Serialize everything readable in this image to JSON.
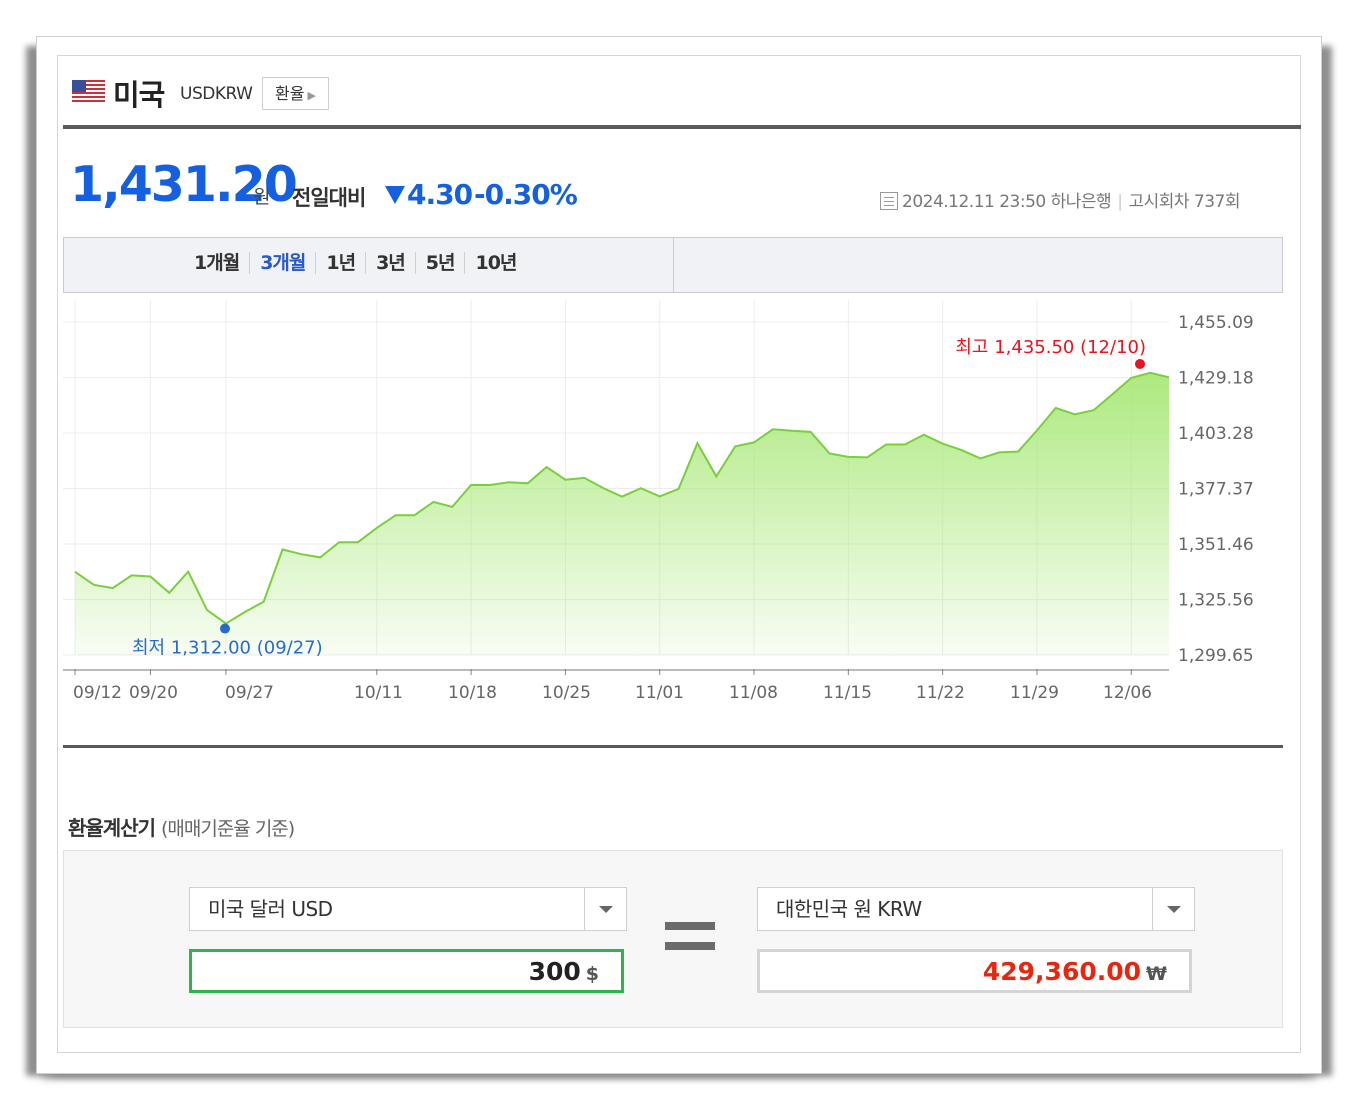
{
  "header": {
    "country": "미국",
    "code": "USDKRW",
    "fx_button": "환율",
    "flag_icon": "us-flag-icon"
  },
  "quote": {
    "price": "1,431.20",
    "currency_unit": "원",
    "compare_label": "전일대비",
    "change": "4.30",
    "change_pct": "-0.30%",
    "direction": "down",
    "timestamp": "2024.12.11 23:50",
    "bank": "하나은행",
    "notice": "고시회차 737회"
  },
  "tabs": [
    "1개월",
    "3개월",
    "1년",
    "3년",
    "5년",
    "10년"
  ],
  "active_tab": "3개월",
  "chart_data": {
    "type": "area",
    "ylim": [
      1299.65,
      1455.09
    ],
    "y_ticks": [
      "1,455.09",
      "1,429.18",
      "1,403.28",
      "1,377.37",
      "1,351.46",
      "1,325.56",
      "1,299.65"
    ],
    "x_ticks": [
      "09/12",
      "09/20",
      "09/27",
      "10/11",
      "10/18",
      "10/25",
      "11/01",
      "11/08",
      "11/15",
      "11/22",
      "11/29",
      "12/06"
    ],
    "values": [
      1338.5,
      1332.4,
      1330.9,
      1336.8,
      1336.3,
      1328.7,
      1338.6,
      1320.7,
      1314.3,
      1319.7,
      1324.5,
      1348.9,
      1346.7,
      1345.2,
      1352.3,
      1352.3,
      1359.0,
      1364.9,
      1364.9,
      1371.1,
      1368.8,
      1379.0,
      1379.0,
      1380.3,
      1379.8,
      1387.4,
      1381.5,
      1382.3,
      1377.6,
      1373.6,
      1377.5,
      1373.7,
      1377.2,
      1398.5,
      1383.0,
      1397.0,
      1398.9,
      1405.0,
      1404.3,
      1403.8,
      1393.7,
      1392.1,
      1391.9,
      1397.9,
      1397.9,
      1402.5,
      1398.3,
      1395.3,
      1391.4,
      1394.2,
      1394.6,
      1404.5,
      1415.0,
      1412.0,
      1413.9,
      1421.4,
      1429.0,
      1431.4,
      1429.3
    ],
    "max_label": "최고",
    "max_value": "1,435.50",
    "max_date": "(12/10)",
    "min_label": "최저",
    "min_value": "1,312.00",
    "min_date": "(09/27)",
    "line_color": "#79cf3c",
    "fill_color": "#a8e878",
    "max_color": "#e8141e",
    "min_color": "#2a6acc"
  },
  "calculator": {
    "title": "환율계산기",
    "subtitle": "(매매기준율 기준)",
    "from_currency": "미국 달러 USD",
    "from_amount": "300",
    "from_unit": "$",
    "to_currency": "대한민국 원 KRW",
    "to_amount": "429,360.00",
    "to_unit": "₩",
    "from_border": "#2fb34b",
    "to_color": "#e8250d"
  }
}
